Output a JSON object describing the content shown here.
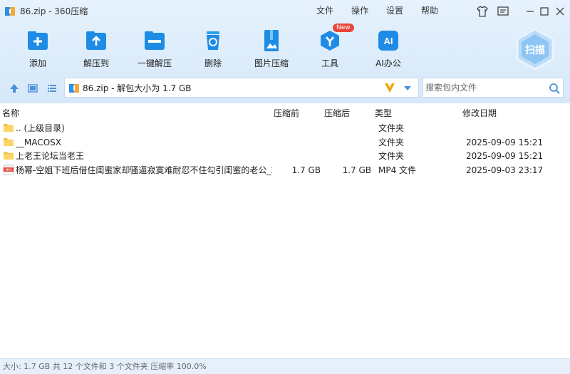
{
  "window": {
    "title": "86.zip - 360压缩"
  },
  "menu": [
    "文件",
    "操作",
    "设置",
    "帮助"
  ],
  "toolbar": [
    {
      "label": "添加",
      "icon": "add-icon"
    },
    {
      "label": "解压到",
      "icon": "extract-to-icon"
    },
    {
      "label": "一键解压",
      "icon": "one-click-extract-icon"
    },
    {
      "label": "删除",
      "icon": "trash-icon"
    },
    {
      "label": "图片压缩",
      "icon": "image-compress-icon"
    },
    {
      "label": "工具",
      "icon": "tools-icon",
      "badge": "New"
    },
    {
      "label": "AI办公",
      "icon": "ai-office-icon",
      "icon_text": "AI"
    }
  ],
  "scan": {
    "label": "扫描"
  },
  "address": {
    "path": "86.zip - 解包大小为 1.7 GB"
  },
  "search": {
    "placeholder": "搜索包内文件"
  },
  "columns": {
    "name": "名称",
    "compressed_before": "压缩前",
    "compressed_after": "压缩后",
    "type": "类型",
    "modified": "修改日期"
  },
  "files": [
    {
      "name": ".. (上级目录)",
      "size": "",
      "csize": "",
      "type": "文件夹",
      "date": "",
      "icon": "folder-icon"
    },
    {
      "name": "__MACOSX",
      "size": "",
      "csize": "",
      "type": "文件夹",
      "date": "2025-09-09 15:21",
      "icon": "folder-icon"
    },
    {
      "name": "上老王论坛当老王",
      "size": "",
      "csize": "",
      "type": "文件夹",
      "date": "2025-09-09 15:21",
      "icon": "folder-icon"
    },
    {
      "name": "杨幂-空姐下班后借住闺蜜家却骚逼寂寞难耐忍不住勾引闺蜜的老公_2...",
      "size": "1.7 GB",
      "csize": "1.7 GB",
      "type": "MP4 文件",
      "date": "2025-09-03 23:17",
      "icon": "video-file-icon",
      "icon_text": "MP4"
    }
  ],
  "status": "大小: 1.7 GB 共 12 个文件和 3 个文件夹 压缩率 100.0%",
  "colors": {
    "accent": "#1e8ce6",
    "toolbar_bg": "#dcecfb",
    "folder": "#f5c242",
    "badge": "#e8463c",
    "status_bg": "#e5f0fb"
  }
}
